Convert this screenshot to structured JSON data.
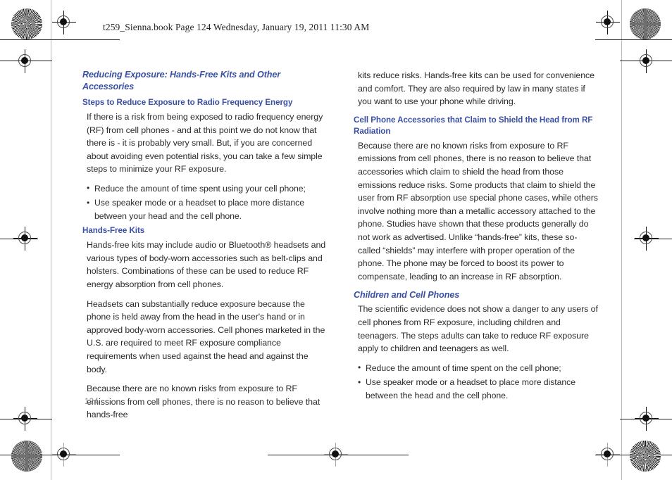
{
  "document": {
    "running_header": "t259_Sienna.book  Page 124  Wednesday, January 19, 2011  11:30 AM",
    "page_number": "124",
    "heading_color": "#3a4fa4",
    "body_color": "#2b2b2b",
    "page_number_color": "#8a8a8a"
  },
  "left_column": {
    "section_title": "Reducing Exposure: Hands-Free Kits and Other Accessories",
    "sub_title_1": "Steps to Reduce Exposure to Radio Frequency Energy",
    "paragraph_1": "If there is a risk from being exposed to radio frequency energy (RF) from cell phones - and at this point we do not know that there is - it is probably very small. But, if you are concerned about avoiding even potential risks, you can take a few simple steps to minimize your RF exposure.",
    "bullets_1": [
      "Reduce the amount of time spent using your cell phone;",
      "Use speaker mode or a headset to place more distance between your head and the cell phone."
    ],
    "sub_title_2": "Hands-Free Kits",
    "paragraph_2": "Hands-free kits may include audio or Bluetooth® headsets and various types of body-worn accessories such as belt-clips and holsters. Combinations of these can be used to reduce RF energy absorption from cell phones.",
    "paragraph_3": "Headsets can substantially reduce exposure because the phone is held away from the head in the user's hand or in approved body-worn accessories. Cell phones marketed in the U.S. are required to meet RF exposure compliance requirements when used against the head and against the body.",
    "paragraph_4": "Because there are no known risks from exposure to RF emissions from cell phones, there is no reason to believe that hands-free"
  },
  "right_column": {
    "paragraph_1": "kits reduce risks. Hands-free kits can be used for convenience and comfort. They are also required by law in many states if you want to use your phone while driving.",
    "sub_title_1": "Cell Phone Accessories that Claim to Shield the Head from RF Radiation",
    "paragraph_2": "Because there are no known risks from exposure to RF emissions from cell phones, there is no reason to believe that accessories which claim to shield the head from those emissions reduce risks. Some products that claim to shield the user from RF absorption use special phone cases, while others involve nothing more than a metallic accessory attached to the phone. Studies have shown that these products generally do not work as advertised. Unlike “hands-free” kits, these so-called “shields” may interfere with proper operation of the phone. The phone may be forced to boost its power to compensate, leading to an increase in RF absorption.",
    "section_title": "Children and Cell Phones",
    "paragraph_3": "The scientific evidence does not show a danger to any users of cell phones from RF exposure, including children and teenagers. The steps adults can take to reduce RF exposure apply to children and teenagers as well.",
    "bullets_1": [
      "Reduce the amount of time spent on the cell phone;",
      "Use speaker mode or a headset to place more distance between the head and the cell phone."
    ]
  }
}
